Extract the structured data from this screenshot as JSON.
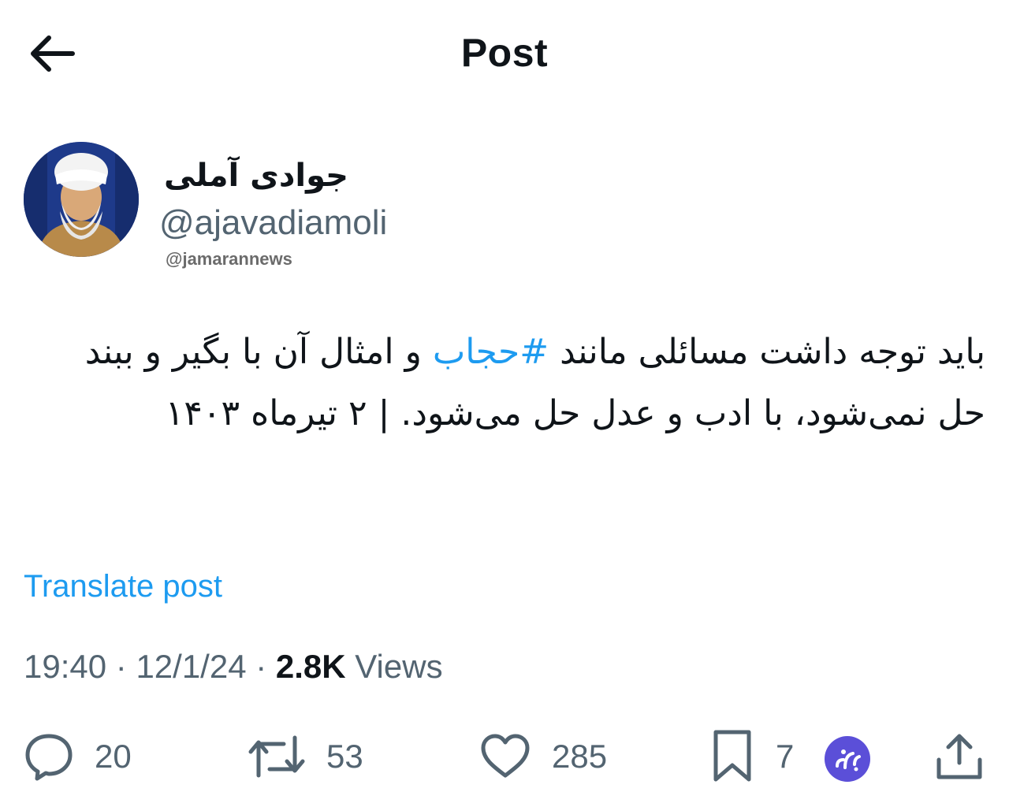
{
  "header": {
    "title": "Post",
    "back_icon": "arrow-left-icon"
  },
  "author": {
    "display_name": "جوادی آملی",
    "handle": "@ajavadiamoli",
    "watermark": "@jamarannews"
  },
  "tweet": {
    "text_before": "باید توجه داشت مسائلی مانند ",
    "hashtag": "#حجاب",
    "text_after": " و امثال آن با بگیر و ببند حل نمی‌شود، با ادب و عدل حل می‌شود. | ۲ تیرماه ۱۴۰۳"
  },
  "translate_label": "Translate post",
  "meta": {
    "time": "19:40",
    "separator": " · ",
    "date": "12/1/24",
    "views_count": "2.8K",
    "views_label": "Views"
  },
  "actions": {
    "replies": "20",
    "reposts": "53",
    "likes": "285",
    "bookmarks": "7"
  },
  "colors": {
    "accent": "#1d9bf0",
    "muted": "#536471",
    "text": "#0f1419",
    "badge": "#5b4fd8"
  }
}
